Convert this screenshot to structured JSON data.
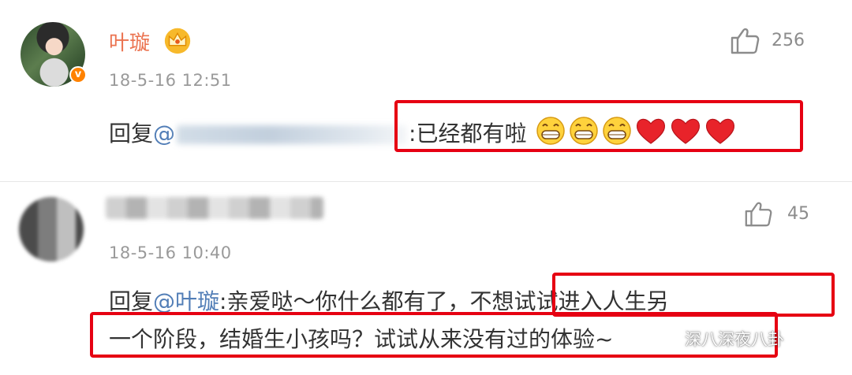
{
  "comments": [
    {
      "username": "叶璇",
      "time": "18-5-16 12:51",
      "likes": "256",
      "reply_prefix": "回复",
      "reply_at": "@",
      "reply_text": ":已经都有啦",
      "emojis": [
        "grin-emoji",
        "grin-emoji",
        "grin-emoji",
        "heart-emoji",
        "heart-emoji",
        "heart-emoji"
      ]
    },
    {
      "username": "",
      "time": "18-5-16 10:40",
      "likes": "45",
      "reply_prefix": "回复",
      "reply_at": "@叶璇",
      "reply_line1": ":亲爱哒～你什么都有了，不想试试进入人生另",
      "reply_line2": "一个阶段，结婚生小孩吗？试试从来没有过的体验~"
    }
  ],
  "watermark": "深八深夜八卦",
  "colors": {
    "username": "#eb7350",
    "mention": "#527eb7",
    "highlight_box": "#e60012",
    "meta": "#9a9a9a"
  },
  "icons": [
    "thumbs-up-icon",
    "verified-badge-icon",
    "crown-icon",
    "wechat-icon"
  ]
}
